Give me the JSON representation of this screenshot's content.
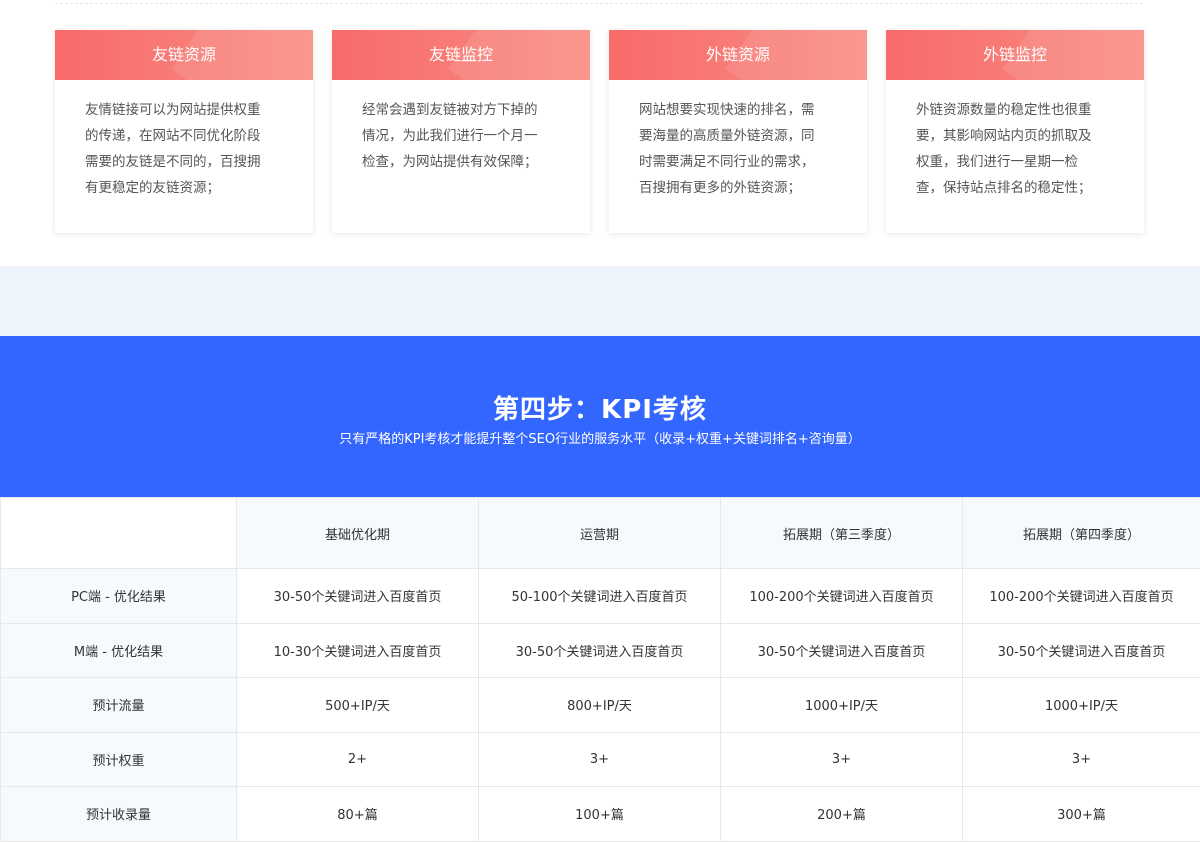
{
  "cards": [
    {
      "title": "友链资源",
      "lines": [
        "友情链接可以为网站提供权重",
        "的传递，在网站不同优化阶段",
        "需要的友链是不同的，百搜拥",
        "有更稳定的友链资源；"
      ]
    },
    {
      "title": "友链监控",
      "lines": [
        "经常会遇到友链被对方下掉的",
        "情况，为此我们进行一个月一",
        "检查，为网站提供有效保障；"
      ]
    },
    {
      "title": "外链资源",
      "lines": [
        "网站想要实现快速的排名，需",
        "要海量的高质量外链资源，同",
        "时需要满足不同行业的需求，",
        "百搜拥有更多的外链资源；"
      ]
    },
    {
      "title": "外链监控",
      "lines": [
        "外链资源数量的稳定性也很重",
        "要，其影响网站内页的抓取及",
        "权重，我们进行一星期一检",
        "查，保持站点排名的稳定性；"
      ]
    }
  ],
  "kpi": {
    "title": "第四步：KPI考核",
    "subtitle": "只有严格的KPI考核才能提升整个SEO行业的服务水平（收录+权重+关键词排名+咨询量）"
  },
  "table": {
    "columns": [
      "",
      "基础优化期",
      "运营期",
      "拓展期（第三季度）",
      "拓展期（第四季度）"
    ],
    "rows": [
      [
        "PC端 - 优化结果",
        "30-50个关键词进入百度首页",
        "50-100个关键词进入百度首页",
        "100-200个关键词进入百度首页",
        "100-200个关键词进入百度首页"
      ],
      [
        "M端 - 优化结果",
        "10-30个关键词进入百度首页",
        "30-50个关键词进入百度首页",
        "30-50个关键词进入百度首页",
        "30-50个关键词进入百度首页"
      ],
      [
        "预计流量",
        "500+IP/天",
        "800+IP/天",
        "1000+IP/天",
        "1000+IP/天"
      ],
      [
        "预计权重",
        "2+",
        "3+",
        "3+",
        "3+"
      ],
      [
        "预计收录量",
        "80+篇",
        "100+篇",
        "200+篇",
        "300+篇"
      ]
    ]
  },
  "colors": {
    "card_header": "#f86b6b",
    "banner": "#3366ff",
    "gap_bg": "#eef4fc",
    "table_label_bg": "#f6f9fd"
  }
}
